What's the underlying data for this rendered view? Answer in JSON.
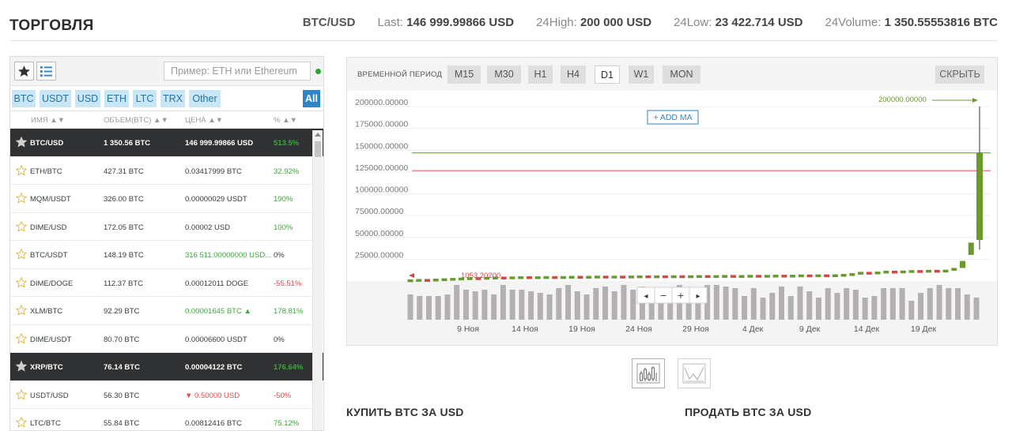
{
  "header": {
    "title": "ТОРГОВЛЯ",
    "pair": "BTC/USD",
    "last_label": "Last:",
    "last_value": "146 999.99866 USD",
    "high_label": "24High:",
    "high_value": "200 000 USD",
    "low_label": "24Low:",
    "low_value": "23 422.714 USD",
    "volume_label": "24Volume:",
    "volume_value": "1 350.55553816 BTC"
  },
  "market": {
    "search_placeholder": "Пример: ETH или Ethereum",
    "currency_tabs": [
      "BTC",
      "USDT",
      "USD",
      "ETH",
      "LTC",
      "TRX",
      "Other"
    ],
    "all_tab": "All",
    "columns": {
      "name": "ИМЯ ▲▼",
      "volume": "ОБЪЕМ(BTC) ▲▼",
      "price": "ЦЕНА ▲▼",
      "change": "% ▲▼"
    },
    "rows": [
      {
        "pair": "BTC/USD",
        "volume": "1 350.56 BTC",
        "price": "146 999.99866 USD",
        "change": "513.5%",
        "favorite": true,
        "selected": true,
        "price_color": "",
        "change_color": "green"
      },
      {
        "pair": "ETH/BTC",
        "volume": "427.31 BTC",
        "price": "0.03417999 BTC",
        "change": "32.92%",
        "favorite": false,
        "selected": false,
        "price_color": "",
        "change_color": "green"
      },
      {
        "pair": "MQM/USDT",
        "volume": "326.00 BTC",
        "price": "0.00000029 USDT",
        "change": "190%",
        "favorite": false,
        "selected": false,
        "price_color": "",
        "change_color": "green"
      },
      {
        "pair": "DIME/USD",
        "volume": "172.05 BTC",
        "price": "0.00002 USD",
        "change": "100%",
        "favorite": false,
        "selected": false,
        "price_color": "",
        "change_color": "green"
      },
      {
        "pair": "BTC/USDT",
        "volume": "148.19 BTC",
        "price": "316 511.00000000 USD...",
        "change": "0%",
        "favorite": false,
        "selected": false,
        "price_color": "green",
        "change_color": ""
      },
      {
        "pair": "DIME/DOGE",
        "volume": "112.37 BTC",
        "price": "0.00012011 DOGE",
        "change": "-55.51%",
        "favorite": false,
        "selected": false,
        "price_color": "",
        "change_color": "red"
      },
      {
        "pair": "XLM/BTC",
        "volume": "92.29 BTC",
        "price": "0.00001645 BTC ▲",
        "change": "178.81%",
        "favorite": false,
        "selected": false,
        "price_color": "green",
        "change_color": "green"
      },
      {
        "pair": "DIME/USDT",
        "volume": "80.70 BTC",
        "price": "0.00006600 USDT",
        "change": "0%",
        "favorite": false,
        "selected": false,
        "price_color": "",
        "change_color": ""
      },
      {
        "pair": "XRP/BTC",
        "volume": "76.14 BTC",
        "price": "0.00004122 BTC",
        "change": "176.64%",
        "favorite": true,
        "selected": true,
        "price_color": "",
        "change_color": "green"
      },
      {
        "pair": "USDT/USD",
        "volume": "56.30 BTC",
        "price": "▼ 0.50000 USD",
        "change": "-50%",
        "favorite": false,
        "selected": false,
        "price_color": "red",
        "change_color": "red"
      },
      {
        "pair": "LTC/BTC",
        "volume": "55.84 BTC",
        "price": "0.00812416 BTC",
        "change": "75.12%",
        "favorite": false,
        "selected": false,
        "price_color": "",
        "change_color": "green"
      }
    ]
  },
  "chart_panel": {
    "period_label": "ВРЕМЕННОЙ ПЕРИОД",
    "periods": [
      "M15",
      "M30",
      "H1",
      "H4",
      "D1",
      "W1",
      "MON"
    ],
    "active_period": "D1",
    "hide_label": "СКРЫТЬ",
    "add_ma_label": "+ ADD MA",
    "max_label": "200000.00000",
    "min_label": "1053.20200",
    "zoom_controls": [
      "◂",
      "−",
      "+",
      "▸"
    ]
  },
  "chart_data": {
    "type": "candlestick",
    "y_ticks": [
      "200000.00000",
      "175000.00000",
      "150000.00000",
      "125000.00000",
      "100000.00000",
      "75000.00000",
      "50000.00000",
      "25000.00000"
    ],
    "ylim": [
      0,
      210000
    ],
    "x_ticks": [
      "9 Ноя",
      "14 Ноя",
      "19 Ноя",
      "24 Ноя",
      "29 Ноя",
      "4 Дек",
      "9 Дек",
      "14 Дек",
      "19 Дек"
    ],
    "hlines": [
      {
        "value": 146999.99866,
        "color": "#7cb342"
      },
      {
        "value": 126500,
        "color": "#e57373"
      }
    ],
    "colors": {
      "up": "#6a9a2c",
      "down": "#d04848",
      "volume": "#b5b0b0"
    },
    "candles": [
      {
        "o": 1053.2,
        "c": 1900
      },
      {
        "o": 1900,
        "c": 2300
      },
      {
        "o": 2300,
        "c": 1900
      },
      {
        "o": 1900,
        "c": 2700
      },
      {
        "o": 2700,
        "c": 3100
      },
      {
        "o": 3100,
        "c": 3500
      },
      {
        "o": 3500,
        "c": 3900
      },
      {
        "o": 3900,
        "c": 4300
      },
      {
        "o": 4300,
        "c": 3900
      },
      {
        "o": 3900,
        "c": 4700
      },
      {
        "o": 4700,
        "c": 5000
      },
      {
        "o": 5000,
        "c": 4700
      },
      {
        "o": 4700,
        "c": 5200
      },
      {
        "o": 5200,
        "c": 5400
      },
      {
        "o": 5400,
        "c": 5100
      },
      {
        "o": 5100,
        "c": 5400
      },
      {
        "o": 5400,
        "c": 5600
      },
      {
        "o": 5600,
        "c": 5400
      },
      {
        "o": 5400,
        "c": 5600
      },
      {
        "o": 5600,
        "c": 5900
      },
      {
        "o": 5900,
        "c": 5600
      },
      {
        "o": 5600,
        "c": 5900
      },
      {
        "o": 5900,
        "c": 6100
      },
      {
        "o": 6100,
        "c": 5800
      },
      {
        "o": 5800,
        "c": 6100
      },
      {
        "o": 6100,
        "c": 5900
      },
      {
        "o": 5900,
        "c": 6200
      },
      {
        "o": 6200,
        "c": 6400
      },
      {
        "o": 6400,
        "c": 6100
      },
      {
        "o": 6100,
        "c": 6400
      },
      {
        "o": 6400,
        "c": 6200
      },
      {
        "o": 6200,
        "c": 6500
      },
      {
        "o": 6500,
        "c": 6300
      },
      {
        "o": 6300,
        "c": 6500
      },
      {
        "o": 6500,
        "c": 6700
      },
      {
        "o": 6700,
        "c": 6400
      },
      {
        "o": 6400,
        "c": 6700
      },
      {
        "o": 6700,
        "c": 6900
      },
      {
        "o": 6900,
        "c": 6600
      },
      {
        "o": 6600,
        "c": 6800
      },
      {
        "o": 6800,
        "c": 7000
      },
      {
        "o": 7000,
        "c": 6700
      },
      {
        "o": 6700,
        "c": 7000
      },
      {
        "o": 7000,
        "c": 7200
      },
      {
        "o": 7200,
        "c": 6900
      },
      {
        "o": 6900,
        "c": 7200
      },
      {
        "o": 7200,
        "c": 7500
      },
      {
        "o": 7500,
        "c": 7200
      },
      {
        "o": 7200,
        "c": 7600
      },
      {
        "o": 7600,
        "c": 7400
      },
      {
        "o": 7400,
        "c": 7700
      },
      {
        "o": 7700,
        "c": 8100
      },
      {
        "o": 8100,
        "c": 9000
      },
      {
        "o": 9000,
        "c": 10500
      },
      {
        "o": 10500,
        "c": 10000
      },
      {
        "o": 10000,
        "c": 10800
      },
      {
        "o": 10800,
        "c": 11800
      },
      {
        "o": 11800,
        "c": 11400
      },
      {
        "o": 11400,
        "c": 12000
      },
      {
        "o": 12000,
        "c": 12500
      },
      {
        "o": 12500,
        "c": 12000
      },
      {
        "o": 12000,
        "c": 12800
      },
      {
        "o": 12800,
        "c": 12500
      },
      {
        "o": 12500,
        "c": 13000
      },
      {
        "o": 13000,
        "c": 15000
      },
      {
        "o": 15000,
        "c": 23000
      },
      {
        "o": 30000,
        "c": 44000
      },
      {
        "o": 47000,
        "c": 147000,
        "h": 200000,
        "l": 36000
      }
    ],
    "volumes": [
      32,
      30,
      30,
      30,
      32,
      44,
      38,
      36,
      38,
      32,
      44,
      38,
      38,
      36,
      34,
      32,
      40,
      44,
      36,
      32,
      40,
      42,
      36,
      44,
      38,
      42,
      38,
      38,
      36,
      44,
      40,
      36,
      44,
      44,
      42,
      40,
      30,
      40,
      28,
      34,
      42,
      30,
      42,
      36,
      28,
      40,
      34,
      40,
      38,
      28,
      30,
      40,
      40,
      40,
      24,
      34,
      40,
      44,
      40,
      40,
      32,
      28
    ]
  },
  "bottom": {
    "buy_title": "КУПИТЬ BTC ЗА USD",
    "sell_title": "ПРОДАТЬ BTC ЗА USD"
  }
}
